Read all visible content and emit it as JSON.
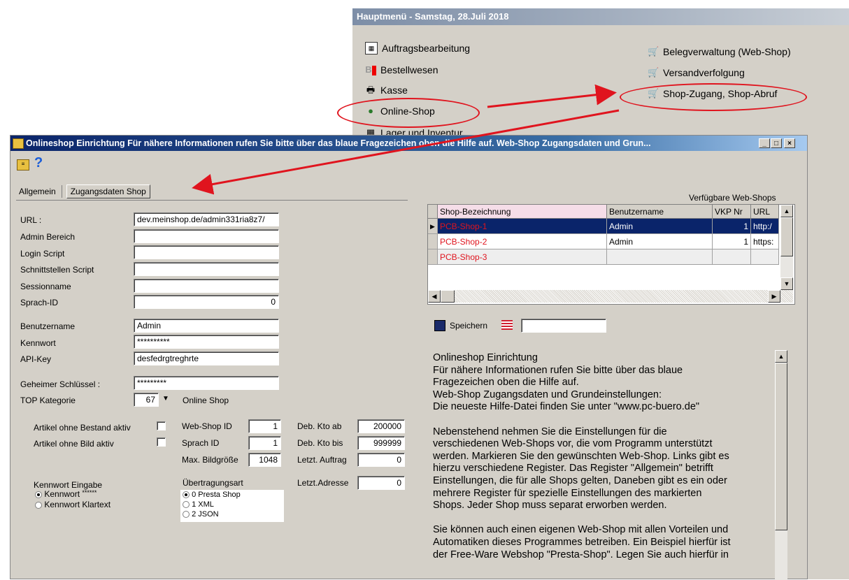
{
  "menu": {
    "title": "Hauptmenü - Samstag, 28.Juli 2018",
    "left_items": [
      {
        "label": "Auftragsbearbeitung",
        "icon": "table-icon"
      },
      {
        "label": "Bestellwesen",
        "icon": "b-icon"
      },
      {
        "label": "Kasse",
        "icon": "printer-icon"
      },
      {
        "label": "Online-Shop",
        "icon": "globe-icon"
      },
      {
        "label": "Lager und Inventur",
        "icon": "grid-icon"
      }
    ],
    "right_items": [
      {
        "label": "Belegverwaltung (Web-Shop)",
        "icon": "cart-icon"
      },
      {
        "label": "Versandverfolgung",
        "icon": "cart-icon"
      },
      {
        "label": "Shop-Zugang, Shop-Abruf",
        "icon": "cart-icon"
      }
    ]
  },
  "dialog": {
    "title": "Onlineshop Einrichtung Für nähere Informationen rufen Sie bitte über das blaue Fragezeichen oben die Hilfe auf. Web-Shop Zugangsdaten und Grun...",
    "buttons": {
      "minimize": "_",
      "maximize": "□",
      "close": "×"
    },
    "tabs": [
      "Allgemein",
      "Zugangsdaten Shop"
    ],
    "fields": {
      "url_label": "URL :",
      "url_value": "dev.meinshop.de/admin331ria8z7/",
      "admin_label": "Admin Bereich",
      "admin_value": "",
      "login_label": "Login Script",
      "login_value": "",
      "schnitt_label": "Schnittstellen Script",
      "schnitt_value": "",
      "session_label": "Sessionname",
      "session_value": "",
      "sprach_label": "Sprach-ID",
      "sprach_value": "0",
      "benutzer_label": "Benutzername",
      "benutzer_value": "Admin",
      "kennwort_label": "Kennwort",
      "kennwort_value": "**********",
      "apikey_label": "API-Key",
      "apikey_value": "desfedrgtreghrte",
      "geheim_label": "Geheimer Schlüssel :",
      "geheim_value": "*********",
      "topkat_label": "TOP Kategorie",
      "topkat_value": "67",
      "topkat_text": "Online Shop"
    },
    "settings": {
      "ohne_bestand_label": "Artikel ohne Bestand aktiv",
      "ohne_bild_label": "Artikel ohne Bild aktiv",
      "webshop_id_label": "Web-Shop ID",
      "webshop_id_value": "1",
      "sprach_id_label": "Sprach ID",
      "sprach_id_value": "1",
      "max_bild_label": "Max. Bildgröße",
      "max_bild_value": "1048",
      "deb_ab_label": "Deb. Kto ab",
      "deb_ab_value": "200000",
      "deb_bis_label": "Deb. Kto bis",
      "deb_bis_value": "999999",
      "letzt_auftrag_label": "Letzt. Auftrag",
      "letzt_auftrag_value": "0",
      "letzt_adresse_label": "Letzt.Adresse",
      "letzt_adresse_value": "0"
    },
    "kennwort_eingabe": {
      "label": "Kennwort Eingabe",
      "option1": "Kennwort",
      "option1_mask": "******",
      "option2": "Kennwort  Klartext"
    },
    "uebertragung": {
      "label": "Übertragungsart",
      "options": [
        "0 Presta Shop",
        "1 XML",
        "2 JSON"
      ]
    },
    "grid": {
      "caption": "Verfügbare Web-Shops",
      "headers": [
        "Shop-Bezeichnung",
        "Benutzername",
        "VKP Nr",
        "URL"
      ],
      "rows": [
        {
          "name": "PCB-Shop-1",
          "user": "Admin",
          "vkp": "1",
          "url": "http:/"
        },
        {
          "name": "PCB-Shop-2",
          "user": "Admin",
          "vkp": "1",
          "url": "https:"
        },
        {
          "name": "PCB-Shop-3",
          "user": "",
          "vkp": "",
          "url": ""
        }
      ]
    },
    "save_label": "Speichern",
    "help_text": "Onlineshop Einrichtung\nFür nähere Informationen rufen Sie bitte über das blaue\nFragezeichen oben die Hilfe auf.\nWeb-Shop Zugangsdaten und Grundeinstellungen:\nDie neueste Hilfe-Datei finden Sie unter \"www.pc-buero.de\"\n\nNebenstehend nehmen Sie die Einstellungen für die\nverschiedenen Web-Shops vor, die vom Programm unterstützt\nwerden. Markieren Sie den gewünschten Web-Shop. Links gibt es\nhierzu verschiedene Register. Das Register \"Allgemein\" betrifft\nEinstellungen, die für alle Shops gelten, Daneben gibt es ein oder\nmehrere Register für spezielle Einstellungen des markierten\nShops. Jeder Shop muss separat erworben werden.\n\nSie können auch einen eigenen Web-Shop mit allen Vorteilen und\nAutomatiken dieses Programmes betreiben. Ein Beispiel hierfür ist\nder Free-Ware Webshop \"Presta-Shop\". Legen Sie auch hierfür in"
  },
  "colors": {
    "annotation": "#e0141e",
    "title_bar": "#0a246a",
    "selected_row": "#0a246a",
    "shop_name": "#e0141e"
  }
}
